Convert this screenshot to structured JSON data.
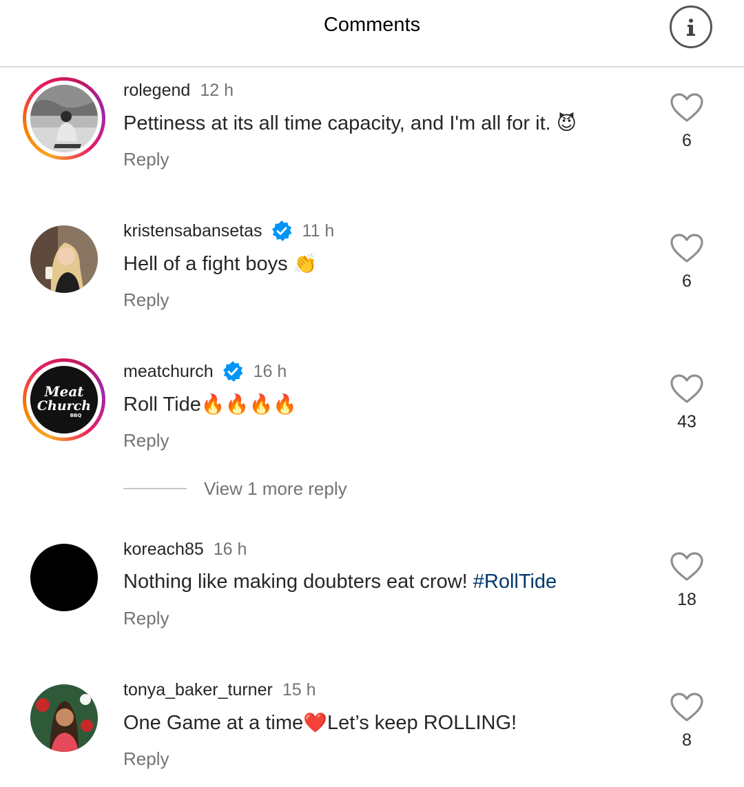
{
  "header": {
    "title": "Comments",
    "info_icon": "info-icon"
  },
  "comments": [
    {
      "username": "rolegend",
      "verified": false,
      "time": "12 h",
      "text": "Pettiness at its all time capacity, and I'm all for it. ",
      "emoji": "😈",
      "reply_label": "Reply",
      "likes": "6",
      "story_ring": true
    },
    {
      "username": "kristensabansetas",
      "verified": true,
      "time": "11 h",
      "text": "Hell of a fight boys ",
      "emoji": "👏",
      "reply_label": "Reply",
      "likes": "6",
      "story_ring": false
    },
    {
      "username": "meatchurch",
      "verified": true,
      "time": "16 h",
      "text": "Roll Tide",
      "emoji": "🔥🔥🔥🔥",
      "reply_label": "Reply",
      "likes": "43",
      "story_ring": true,
      "avatar_text": [
        "Meat",
        "Church",
        "BBQ"
      ],
      "view_more_label": "View 1 more reply"
    },
    {
      "username": "koreach85",
      "verified": false,
      "time": "16 h",
      "text": "Nothing like making doubters eat crow! ",
      "hashtag": "#RollTide",
      "reply_label": "Reply",
      "likes": "18",
      "story_ring": false
    },
    {
      "username": "tonya_baker_turner",
      "verified": false,
      "time": "15 h",
      "text_before": "One Game at a time",
      "emoji": "❤️",
      "text_after": "Let’s keep ROLLING!",
      "reply_label": "Reply",
      "likes": "8",
      "story_ring": false
    }
  ],
  "colors": {
    "text": "#262626",
    "secondary": "#737373",
    "hashtag": "#00376b",
    "verified": "#0095f6",
    "divider": "#dbdbdb"
  }
}
